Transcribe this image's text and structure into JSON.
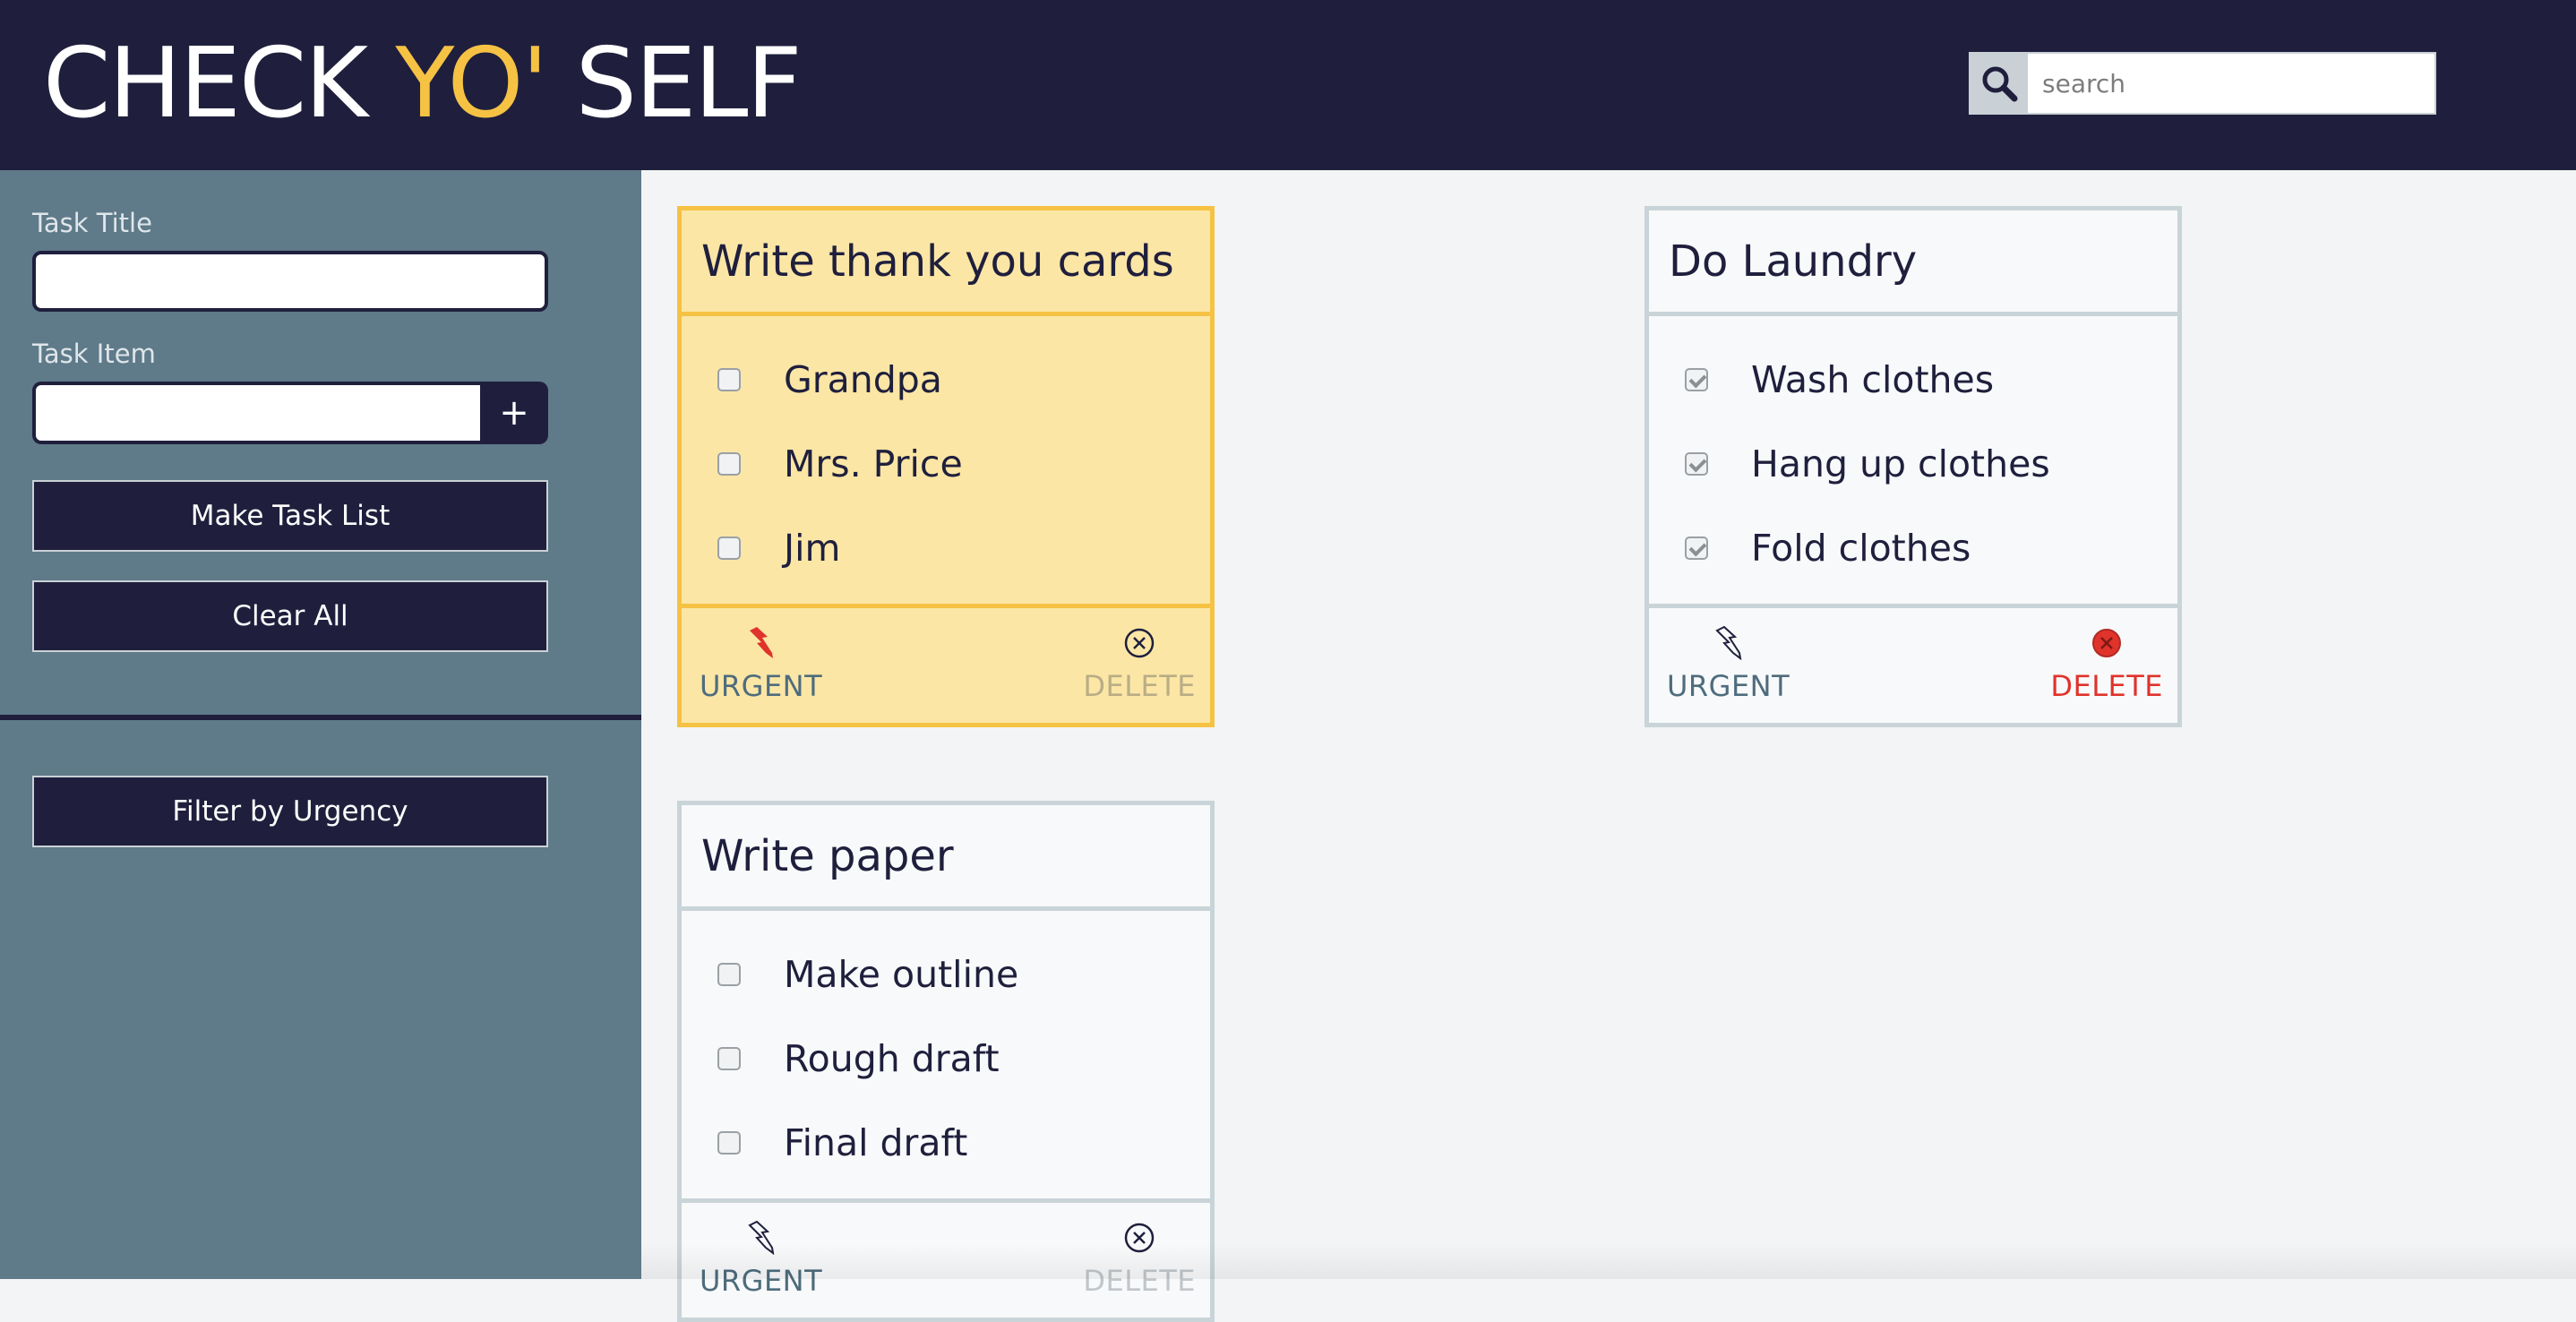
{
  "header": {
    "logo_part1": "CHECK ",
    "logo_accent": "YO'",
    "logo_part2": " SELF",
    "search_placeholder": "search"
  },
  "sidebar": {
    "task_title_label": "Task Title",
    "task_title_value": "",
    "task_item_label": "Task Item",
    "task_item_value": "",
    "add_item_label": "+",
    "make_task_list_label": "Make Task List",
    "clear_all_label": "Clear All",
    "filter_label": "Filter by Urgency"
  },
  "cards": [
    {
      "title": "Write thank you cards",
      "urgent": true,
      "items": [
        {
          "text": "Grandpa",
          "checked": false
        },
        {
          "text": "Mrs. Price",
          "checked": false
        },
        {
          "text": "Jim",
          "checked": false
        }
      ],
      "urgent_label": "URGENT",
      "delete_label": "DELETE"
    },
    {
      "title": "Do Laundry",
      "urgent": false,
      "items": [
        {
          "text": "Wash clothes",
          "checked": true
        },
        {
          "text": "Hang up clothes",
          "checked": true
        },
        {
          "text": "Fold clothes",
          "checked": true
        }
      ],
      "urgent_label": "URGENT",
      "delete_label": "DELETE"
    },
    {
      "title": "Write paper",
      "urgent": false,
      "items": [
        {
          "text": "Make outline",
          "checked": false
        },
        {
          "text": "Rough draft",
          "checked": false
        },
        {
          "text": "Final draft",
          "checked": false
        }
      ],
      "urgent_label": "URGENT",
      "delete_label": "DELETE"
    }
  ],
  "colors": {
    "navy": "#1f1f3d",
    "accent_yellow": "#f6c244",
    "urgent_card_bg": "#fbe6a5",
    "sidebar_bg": "#5f7a89",
    "delete_red": "#e0332b",
    "urgent_red": "#e0332b"
  }
}
